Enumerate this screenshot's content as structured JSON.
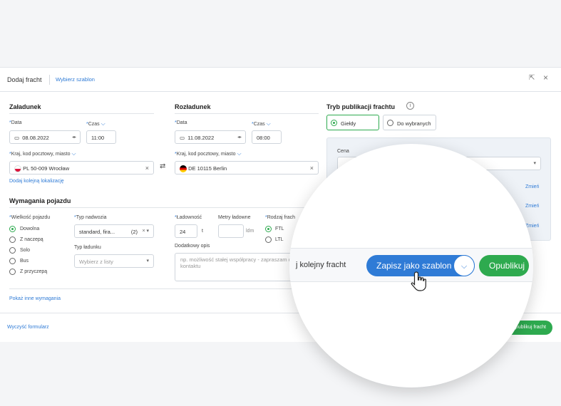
{
  "header": {
    "title": "Dodaj fracht",
    "template_link": "Wybierz szablon",
    "expand_icon": "⇱",
    "close_icon": "×"
  },
  "loading": {
    "title": "Załadunek",
    "date_label": "Data",
    "date_value": "08.08.2022",
    "time_label": "Czas",
    "time_value": "11:00",
    "location_label": "Kraj, kod pocztowy, miasto",
    "location_value": "PL 50-009 Wrocław",
    "add_location": "Dodaj kolejną lokalizację"
  },
  "unloading": {
    "title": "Rozładunek",
    "date_label": "Data",
    "date_value": "11.08.2022",
    "time_label": "Czas",
    "time_value": "08:00",
    "location_label": "Kraj, kod pocztowy, miasto",
    "location_value": "DE 10115 Berlin"
  },
  "publication": {
    "title": "Tryb publikacji frachtu",
    "option_exchanges": "Giełdy",
    "option_selected": "Do wybranych",
    "price_label": "Cena",
    "change_labels": [
      "Zmień",
      "Zmień",
      "Zmień"
    ]
  },
  "vehicle": {
    "title": "Wymagania pojazdu",
    "size_label": "Wielkość pojazdu",
    "sizes": [
      "Dowolna",
      "Z naczepą",
      "Solo",
      "Bus",
      "Z przyczepą"
    ],
    "body_label": "Typ nadwozia",
    "body_value": "standard, fira...",
    "body_count": "(2)",
    "cargo_type_label": "Typ ładunku",
    "cargo_type_placeholder": "Wybierz z listy",
    "capacity_label": "Ładowność",
    "capacity_value": "24",
    "capacity_unit": "t",
    "ldm_label": "Metry ładowne",
    "ldm_unit": "ldm",
    "freight_kind_label": "Rodzaj frach",
    "freight_kinds": [
      "FTL",
      "LTL"
    ],
    "desc_label": "Dodatkowy opis",
    "desc_placeholder": "np. możliwość stałej współpracy - zapraszam do kontaktu",
    "more_requirements": "Pokaż inne wymagania"
  },
  "footer": {
    "clear_form": "Wyczyść formularz",
    "publish_small": "Opublikuj fracht"
  },
  "zoom": {
    "next_freight": "j kolejny fracht",
    "save_template": "Zapisz jako szablon",
    "publish": "Opublikuj"
  },
  "colors": {
    "accent": "#2f7bd6",
    "green": "#2eaa4f",
    "blue_button": "#2f7bd6"
  }
}
